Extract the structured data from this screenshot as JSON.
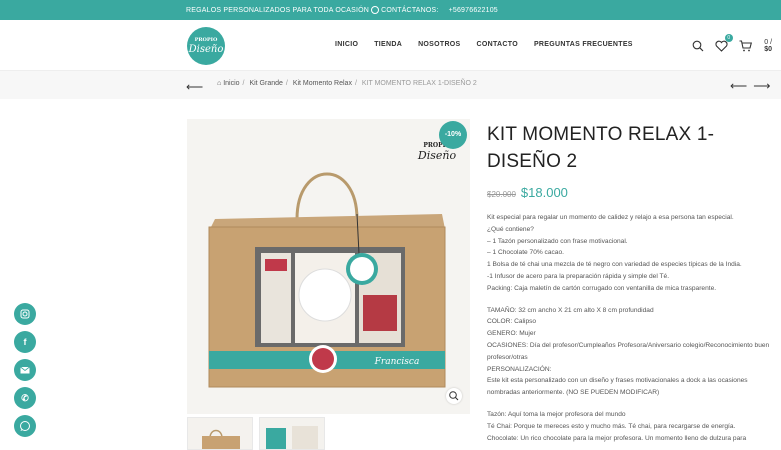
{
  "topbar": {
    "text": "REGALOS PERSONALIZADOS PARA TODA OCASIÓN",
    "contact": "CONTÁCTANOS:",
    "phone": "+56976622105"
  },
  "logo": {
    "line1": "PROPIO",
    "line2": "Diseño"
  },
  "nav": {
    "items": [
      "INICIO",
      "TIENDA",
      "NOSOTROS",
      "CONTACTO",
      "PREGUNTAS FRECUENTES"
    ]
  },
  "header": {
    "wishlist_count": "0",
    "cart_count": "0",
    "cart_total": "$0"
  },
  "breadcrumb": {
    "items": [
      "Inicio",
      "Kit Grande",
      "Kit Momento Relax"
    ],
    "current": "KIT MOMENTO RELAX 1-DISEÑO 2"
  },
  "product": {
    "discount": "-10%",
    "title": "KIT MOMENTO RELAX 1-DISEÑO 2",
    "old_price": "$20.000",
    "price": "$18.000",
    "image": {
      "box_logo": "PROPIO Diseño",
      "name_label": "Francisca",
      "tag_text": "PROPIO Diseño"
    },
    "description": [
      "Kit especial para regalar un momento de calidez y relajo a esa persona tan especial.",
      "¿Qué contiene?",
      "– 1 Tazón personalizado con frase motivacional.",
      "– 1 Chocolate 70% cacao.",
      "1 Bolsa de té chai una mezcla de té negro con variedad de especies típicas de la India.",
      "-1 Infusor de acero para la preparación rápida y simple del Té.",
      "Packing: Caja maletín de cartón corrugado con ventanilla de mica trasparente.",
      "",
      "TAMAÑO: 32 cm ancho X 21 cm alto X 8 cm profundidad",
      "COLOR: Calipso",
      "GENERO: Mujer",
      "OCASIONES: Día del profesor/Cumpleaños Profesora/Aniversario colegio/Reconocimiento buen profesor/otras",
      "PERSONALIZACIÓN:",
      "Este kit esta personalizado con un diseño y frases motivacionales a dock a las ocasiones nombradas anteriormente. (NO SE PUEDEN MODIFICAR)",
      "",
      "Tazón: Aquí toma la mejor profesora del mundo",
      "Té Chai: Porque te mereces esto y mucho más. Té chai, para recargarse de energía.",
      "Chocolate: Un rico chocolate para la mejor profesora. Un momento lleno de dulzura para"
    ]
  },
  "social": [
    "instagram-icon",
    "facebook-icon",
    "email-icon",
    "phone-icon",
    "whatsapp-icon"
  ],
  "colors": {
    "accent": "#3aa9a0"
  }
}
